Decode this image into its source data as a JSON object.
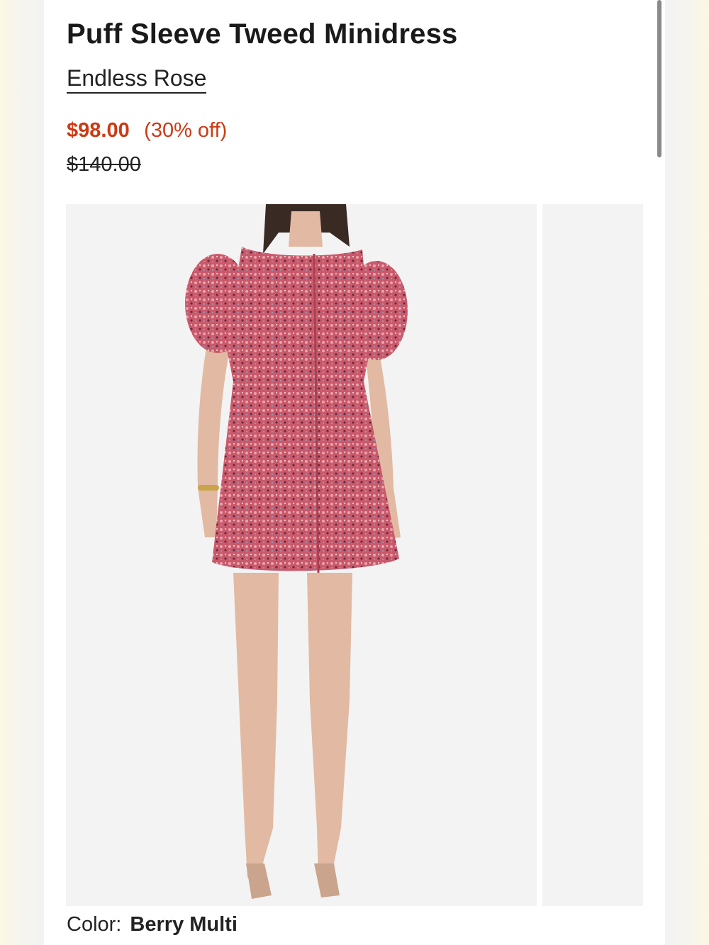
{
  "product": {
    "title": "Puff Sleeve Tweed Minidress",
    "brand": "Endless Rose",
    "sale_price": "$98.00",
    "discount": "(30% off)",
    "original_price": "$140.00",
    "color_label": "Color:",
    "color_value": "Berry Multi"
  },
  "colors": {
    "sale": "#cc3a14",
    "text": "#1a1a1a",
    "image_bg": "#f3f3f3",
    "dress": "#c95a6c"
  }
}
